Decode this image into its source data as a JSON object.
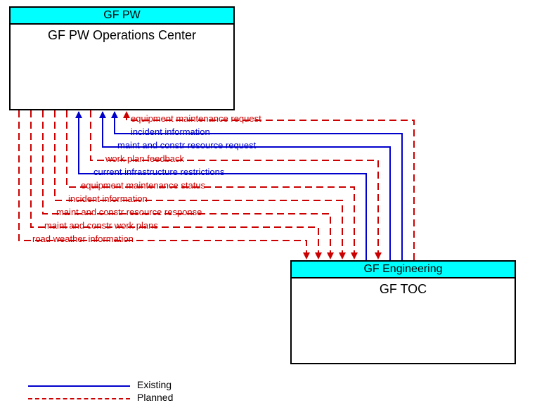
{
  "nodes": {
    "gfpw": {
      "header": "GF PW",
      "title": "GF PW Operations Center"
    },
    "gfeng": {
      "header": "GF Engineering",
      "title": "GF TOC"
    }
  },
  "flows": {
    "f0": {
      "label": "equipment maintenance request",
      "style": "planned",
      "dir": "to_gfpw"
    },
    "f1": {
      "label": "incident information",
      "style": "existing",
      "dir": "to_gfpw"
    },
    "f2": {
      "label": "maint and constr resource request",
      "style": "existing",
      "dir": "to_gfpw"
    },
    "f3": {
      "label": "work plan feedback",
      "style": "planned",
      "dir": "to_gftoc"
    },
    "f4": {
      "label": "current infrastructure restrictions",
      "style": "existing",
      "dir": "to_gfpw"
    },
    "f5": {
      "label": "equipment maintenance status",
      "style": "planned",
      "dir": "to_gftoc"
    },
    "f6": {
      "label": "incident information",
      "style": "planned",
      "dir": "to_gftoc"
    },
    "f7": {
      "label": "maint and constr resource response",
      "style": "planned",
      "dir": "to_gftoc"
    },
    "f8": {
      "label": "maint and constr work plans",
      "style": "planned",
      "dir": "to_gftoc"
    },
    "f9": {
      "label": "road weather information",
      "style": "planned",
      "dir": "to_gftoc"
    }
  },
  "legend": {
    "existing": "Existing",
    "planned": "Planned"
  },
  "chart_data": {
    "type": "diagram",
    "nodes": [
      {
        "id": "GF_PW_Operations_Center",
        "group": "GF PW",
        "label": "GF PW Operations Center"
      },
      {
        "id": "GF_TOC",
        "group": "GF Engineering",
        "label": "GF TOC"
      }
    ],
    "edges": [
      {
        "from": "GF_TOC",
        "to": "GF_PW_Operations_Center",
        "label": "equipment maintenance request",
        "status": "Planned"
      },
      {
        "from": "GF_TOC",
        "to": "GF_PW_Operations_Center",
        "label": "incident information",
        "status": "Existing"
      },
      {
        "from": "GF_TOC",
        "to": "GF_PW_Operations_Center",
        "label": "maint and constr resource request",
        "status": "Existing"
      },
      {
        "from": "GF_PW_Operations_Center",
        "to": "GF_TOC",
        "label": "work plan feedback",
        "status": "Planned"
      },
      {
        "from": "GF_TOC",
        "to": "GF_PW_Operations_Center",
        "label": "current infrastructure restrictions",
        "status": "Existing"
      },
      {
        "from": "GF_PW_Operations_Center",
        "to": "GF_TOC",
        "label": "equipment maintenance status",
        "status": "Planned"
      },
      {
        "from": "GF_PW_Operations_Center",
        "to": "GF_TOC",
        "label": "incident information",
        "status": "Planned"
      },
      {
        "from": "GF_PW_Operations_Center",
        "to": "GF_TOC",
        "label": "maint and constr resource response",
        "status": "Planned"
      },
      {
        "from": "GF_PW_Operations_Center",
        "to": "GF_TOC",
        "label": "maint and constr work plans",
        "status": "Planned"
      },
      {
        "from": "GF_PW_Operations_Center",
        "to": "GF_TOC",
        "label": "road weather information",
        "status": "Planned"
      }
    ],
    "legend": {
      "Existing": "solid-blue",
      "Planned": "dashed-red"
    }
  }
}
